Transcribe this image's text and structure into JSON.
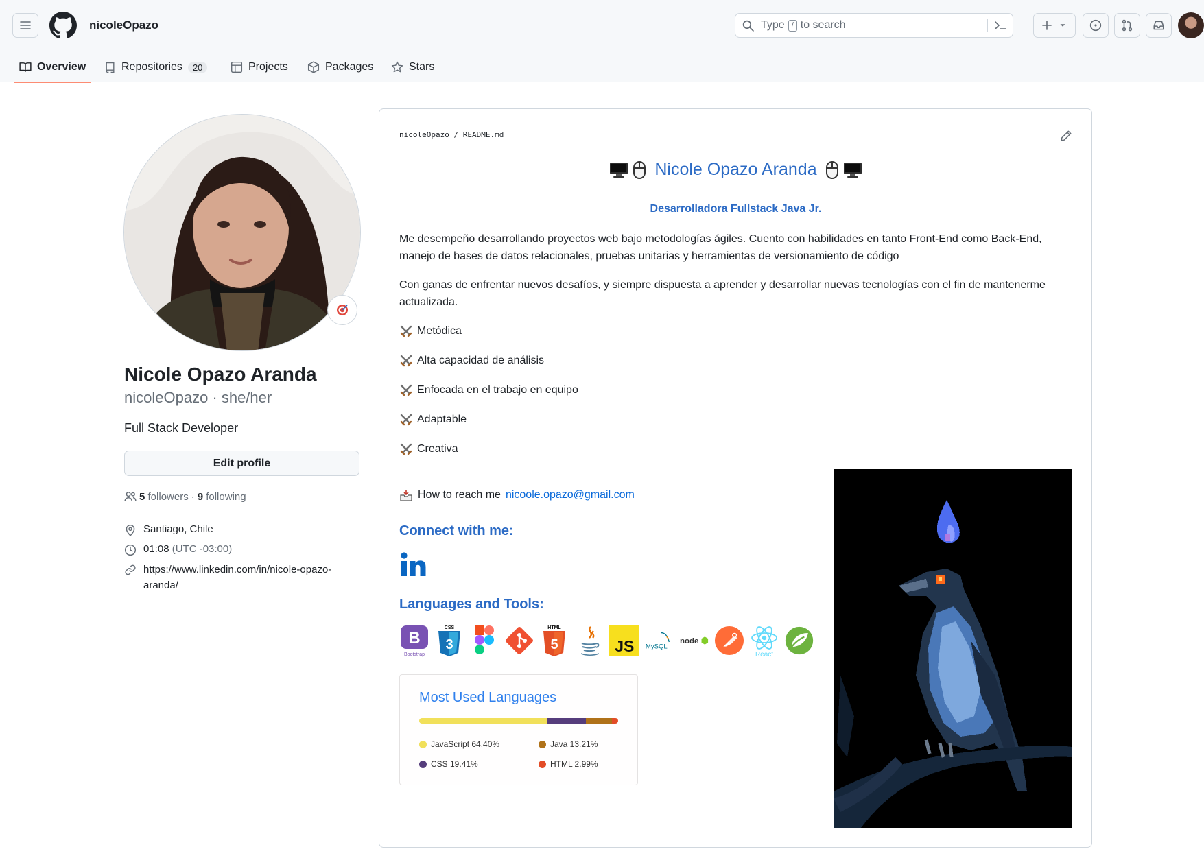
{
  "header": {
    "username": "nicoleOpazo",
    "search": {
      "placeholder_before": "Type",
      "placeholder_key": "/",
      "placeholder_after": "to search"
    }
  },
  "tabs": [
    {
      "label": "Overview",
      "icon": "book-icon",
      "active": true
    },
    {
      "label": "Repositories",
      "icon": "repo-icon",
      "count": "20"
    },
    {
      "label": "Projects",
      "icon": "table-icon"
    },
    {
      "label": "Packages",
      "icon": "package-icon"
    },
    {
      "label": "Stars",
      "icon": "star-icon"
    }
  ],
  "profile": {
    "full_name": "Nicole Opazo Aranda",
    "login": "nicoleOpazo",
    "pronouns": "she/her",
    "login_line": "nicoleOpazo · she/her",
    "bio": "Full Stack Developer",
    "edit_label": "Edit profile",
    "followers_count": "5",
    "followers_label": "followers",
    "following_count": "9",
    "following_label": "following",
    "location": "Santiago, Chile",
    "time": "01:08",
    "timezone": "(UTC -03:00)",
    "website_line1": "https://www.linkedin.com/in/nicole-opazo-",
    "website_line2": "aranda/"
  },
  "readme": {
    "crumb_owner": "nicoleOpazo",
    "crumb_sep": "/",
    "crumb_file": "README.md",
    "title": "Nicole Opazo Aranda",
    "subtitle": "Desarrolladora Fullstack Java Jr.",
    "para1_line1": "Me desempeño desarrollando proyectos web bajo metodologías ágiles. Cuento con habilidades en tanto Front-End como Back-End,",
    "para1_line2": "manejo de bases de datos relacionales, pruebas unitarias y herramientas de versionamiento de código",
    "para2_line1": "Con ganas de enfrentar nuevos desafíos, y siempre dispuesta a aprender y desarrollar nuevas tecnologías con el fin de mantenerme",
    "para2_line2": "actualizada.",
    "skills": [
      "Metódica",
      "Alta capacidad de análisis",
      "Enfocada en el trabajo en equipo",
      "Adaptable",
      "Creativa"
    ],
    "reach_label": "How to reach me",
    "reach_email": "nicoole.opazo@gmail.com",
    "connect_heading": "Connect with me:",
    "tools_heading": "Languages and Tools:",
    "tools": [
      "bootstrap-icon",
      "css3-icon",
      "figma-icon",
      "git-icon",
      "html5-icon",
      "java-icon",
      "javascript-icon",
      "mysql-icon",
      "nodejs-icon",
      "postman-icon",
      "react-icon",
      "spring-icon"
    ],
    "tool_labels": {
      "bootstrap": "Bootstrap",
      "css": "CSS",
      "html": "HTML",
      "js": "JS",
      "mysql": "MySQL",
      "node": "node",
      "react": "React"
    },
    "languages_card": {
      "title": "Most Used Languages",
      "items": [
        {
          "name": "JavaScript",
          "pct": 64.4,
          "label": "JavaScript 64.40%",
          "color": "#f1e05a"
        },
        {
          "name": "CSS",
          "pct": 19.41,
          "label": "CSS 19.41%",
          "color": "#563d7c"
        },
        {
          "name": "Java",
          "pct": 13.21,
          "label": "Java 13.21%",
          "color": "#b07219"
        },
        {
          "name": "HTML",
          "pct": 2.99,
          "label": "HTML 2.99%",
          "color": "#e34c26"
        }
      ]
    }
  },
  "colors": {
    "accent_tab": "#fd8c73",
    "link": "#0969da",
    "readme_blue": "#2c6bc5"
  }
}
